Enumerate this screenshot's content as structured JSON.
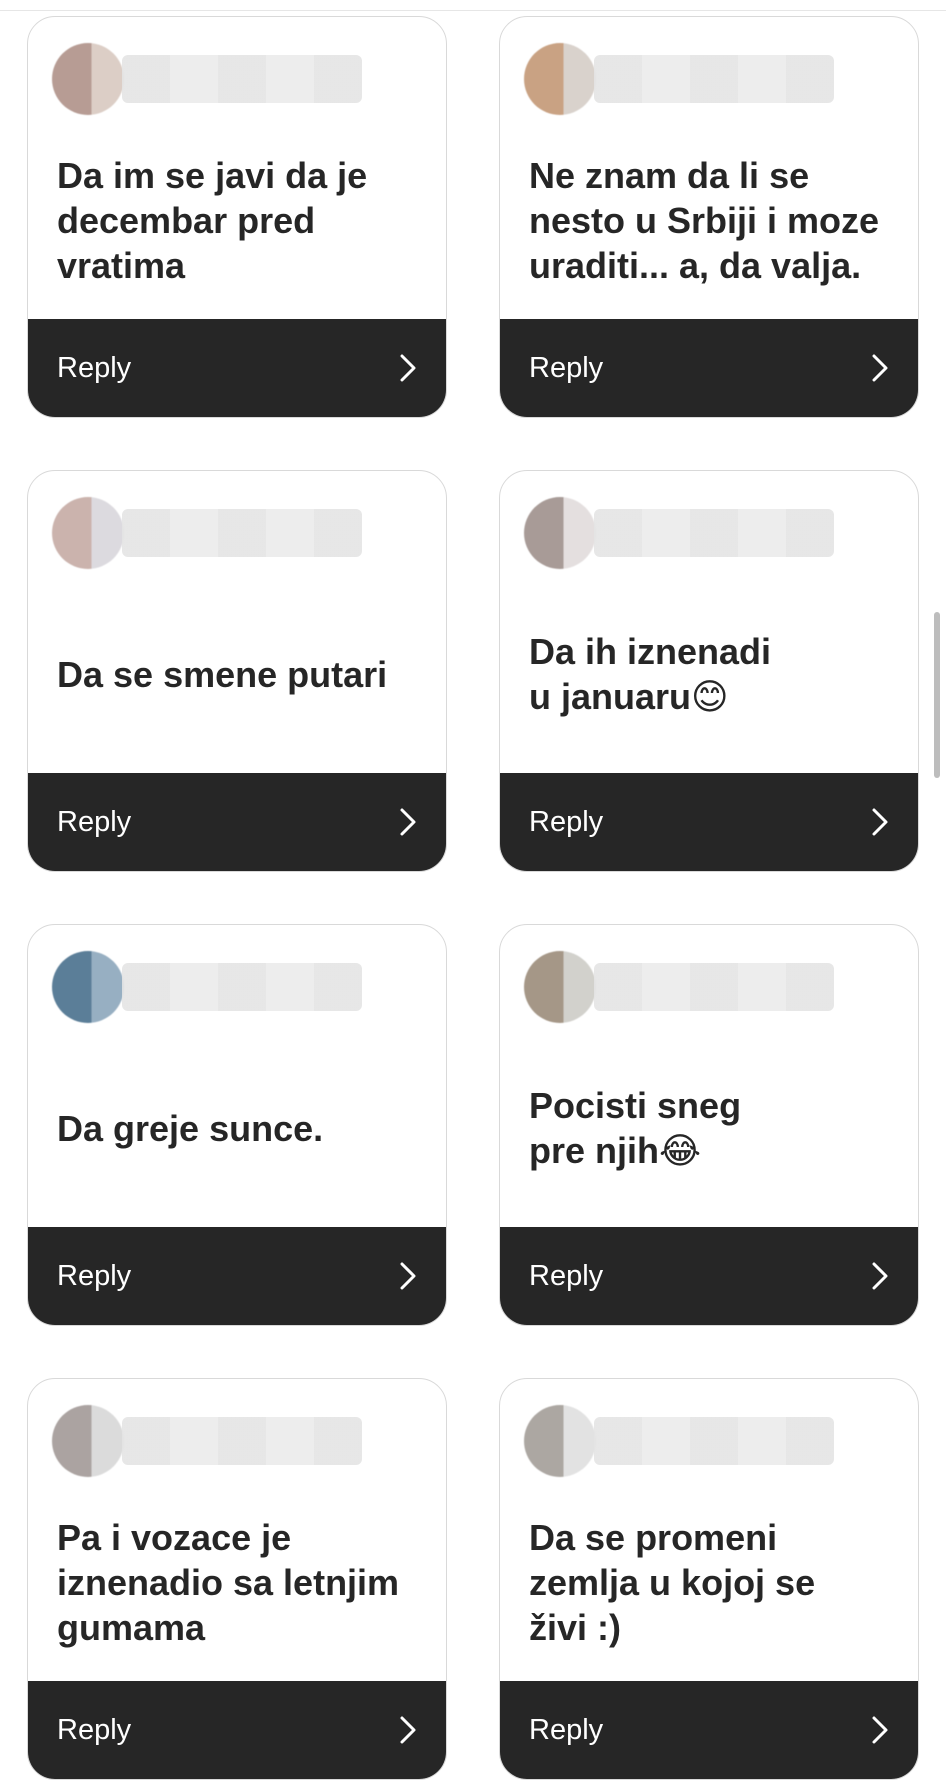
{
  "reply_label": "Reply",
  "colors": {
    "reply_bar": "#262626",
    "message_text": "#262626",
    "card_border": "#d9d9d9"
  },
  "icons": {
    "reply_arrow": "chevron-right-icon"
  },
  "cards": [
    {
      "message": "Da im se javi da je\ndecembar pred\nvratima",
      "avatar_colors": [
        "#b79c94",
        "#dccec6"
      ]
    },
    {
      "message": "Ne znam da li se\nnesto u Srbiji i moze\nuraditi... a, da valja.",
      "avatar_colors": [
        "#c9a283",
        "#d9d2cc"
      ]
    },
    {
      "message": "Da se smene putari",
      "avatar_colors": [
        "#cbb3ad",
        "#dcdadf"
      ]
    },
    {
      "message": "Da ih iznenadi\nu januaru😊",
      "avatar_colors": [
        "#a89b97",
        "#e4dfdf"
      ]
    },
    {
      "message": "Da greje sunce.",
      "avatar_colors": [
        "#5b7e98",
        "#97afc2"
      ]
    },
    {
      "message": "Pocisti sneg\npre njih😂",
      "avatar_colors": [
        "#a59787",
        "#d2d1cc"
      ]
    },
    {
      "message": "Pa i vozace je\niznenadio sa letnjim\ngumama",
      "avatar_colors": [
        "#aba3a1",
        "#dbdbdb"
      ]
    },
    {
      "message": "Da se promeni\nzemlja u kojoj se\nživi :)",
      "avatar_colors": [
        "#aca7a2",
        "#e2e2e2"
      ]
    }
  ]
}
